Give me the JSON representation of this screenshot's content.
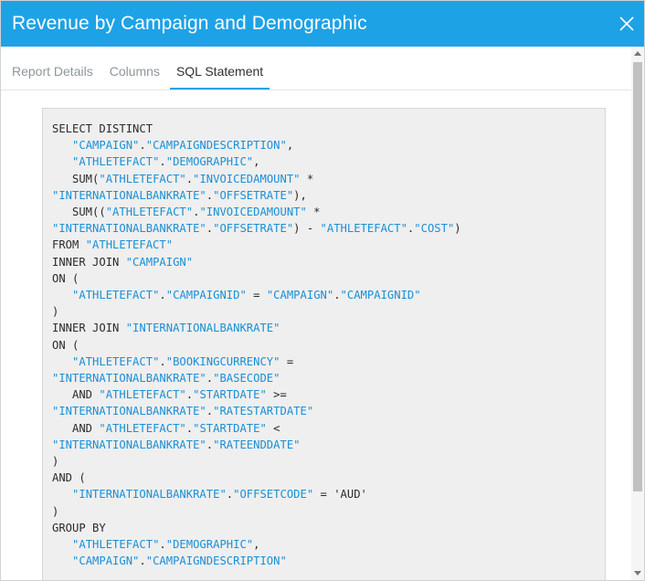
{
  "dialog": {
    "title": "Revenue by Campaign and Demographic",
    "close_icon": "close-icon"
  },
  "tabs": [
    {
      "label": "Report Details",
      "active": false
    },
    {
      "label": "Columns",
      "active": false
    },
    {
      "label": "SQL Statement",
      "active": true
    }
  ],
  "sql": {
    "lines": [
      [
        [
          "kw",
          "SELECT DISTINCT"
        ]
      ],
      [
        [
          "kw",
          "   "
        ],
        [
          "id",
          "\"CAMPAIGN\""
        ],
        [
          "kw",
          "."
        ],
        [
          "id",
          "\"CAMPAIGNDESCRIPTION\""
        ],
        [
          "kw",
          ","
        ]
      ],
      [
        [
          "kw",
          "   "
        ],
        [
          "id",
          "\"ATHLETEFACT\""
        ],
        [
          "kw",
          "."
        ],
        [
          "id",
          "\"DEMOGRAPHIC\""
        ],
        [
          "kw",
          ","
        ]
      ],
      [
        [
          "kw",
          "   SUM("
        ],
        [
          "id",
          "\"ATHLETEFACT\""
        ],
        [
          "kw",
          "."
        ],
        [
          "id",
          "\"INVOICEDAMOUNT\""
        ],
        [
          "kw",
          " *"
        ]
      ],
      [
        [
          "id",
          "\"INTERNATIONALBANKRATE\""
        ],
        [
          "kw",
          "."
        ],
        [
          "id",
          "\"OFFSETRATE\""
        ],
        [
          "kw",
          "),"
        ]
      ],
      [
        [
          "kw",
          "   SUM(("
        ],
        [
          "id",
          "\"ATHLETEFACT\""
        ],
        [
          "kw",
          "."
        ],
        [
          "id",
          "\"INVOICEDAMOUNT\""
        ],
        [
          "kw",
          " *"
        ]
      ],
      [
        [
          "id",
          "\"INTERNATIONALBANKRATE\""
        ],
        [
          "kw",
          "."
        ],
        [
          "id",
          "\"OFFSETRATE\""
        ],
        [
          "kw",
          ") - "
        ],
        [
          "id",
          "\"ATHLETEFACT\""
        ],
        [
          "kw",
          "."
        ],
        [
          "id",
          "\"COST\""
        ],
        [
          "kw",
          ")"
        ]
      ],
      [
        [
          "kw",
          "FROM "
        ],
        [
          "id",
          "\"ATHLETEFACT\""
        ]
      ],
      [
        [
          "kw",
          "INNER JOIN "
        ],
        [
          "id",
          "\"CAMPAIGN\""
        ]
      ],
      [
        [
          "kw",
          "ON ("
        ]
      ],
      [
        [
          "kw",
          "   "
        ],
        [
          "id",
          "\"ATHLETEFACT\""
        ],
        [
          "kw",
          "."
        ],
        [
          "id",
          "\"CAMPAIGNID\""
        ],
        [
          "kw",
          " = "
        ],
        [
          "id",
          "\"CAMPAIGN\""
        ],
        [
          "kw",
          "."
        ],
        [
          "id",
          "\"CAMPAIGNID\""
        ]
      ],
      [
        [
          "kw",
          ")"
        ]
      ],
      [
        [
          "kw",
          "INNER JOIN "
        ],
        [
          "id",
          "\"INTERNATIONALBANKRATE\""
        ]
      ],
      [
        [
          "kw",
          "ON ("
        ]
      ],
      [
        [
          "kw",
          "   "
        ],
        [
          "id",
          "\"ATHLETEFACT\""
        ],
        [
          "kw",
          "."
        ],
        [
          "id",
          "\"BOOKINGCURRENCY\""
        ],
        [
          "kw",
          " ="
        ]
      ],
      [
        [
          "id",
          "\"INTERNATIONALBANKRATE\""
        ],
        [
          "kw",
          "."
        ],
        [
          "id",
          "\"BASECODE\""
        ]
      ],
      [
        [
          "kw",
          "   AND "
        ],
        [
          "id",
          "\"ATHLETEFACT\""
        ],
        [
          "kw",
          "."
        ],
        [
          "id",
          "\"STARTDATE\""
        ],
        [
          "kw",
          " >="
        ]
      ],
      [
        [
          "id",
          "\"INTERNATIONALBANKRATE\""
        ],
        [
          "kw",
          "."
        ],
        [
          "id",
          "\"RATESTARTDATE\""
        ]
      ],
      [
        [
          "kw",
          "   AND "
        ],
        [
          "id",
          "\"ATHLETEFACT\""
        ],
        [
          "kw",
          "."
        ],
        [
          "id",
          "\"STARTDATE\""
        ],
        [
          "kw",
          " <"
        ]
      ],
      [
        [
          "id",
          "\"INTERNATIONALBANKRATE\""
        ],
        [
          "kw",
          "."
        ],
        [
          "id",
          "\"RATEENDDATE\""
        ]
      ],
      [
        [
          "kw",
          ")"
        ]
      ],
      [
        [
          "kw",
          "AND ("
        ]
      ],
      [
        [
          "kw",
          "   "
        ],
        [
          "id",
          "\"INTERNATIONALBANKRATE\""
        ],
        [
          "kw",
          "."
        ],
        [
          "id",
          "\"OFFSETCODE\""
        ],
        [
          "kw",
          " = 'AUD'"
        ]
      ],
      [
        [
          "kw",
          ")"
        ]
      ],
      [
        [
          "kw",
          "GROUP BY"
        ]
      ],
      [
        [
          "kw",
          "   "
        ],
        [
          "id",
          "\"ATHLETEFACT\""
        ],
        [
          "kw",
          "."
        ],
        [
          "id",
          "\"DEMOGRAPHIC\""
        ],
        [
          "kw",
          ","
        ]
      ],
      [
        [
          "kw",
          "   "
        ],
        [
          "id",
          "\"CAMPAIGN\""
        ],
        [
          "kw",
          "."
        ],
        [
          "id",
          "\"CAMPAIGNDESCRIPTION\""
        ]
      ]
    ]
  },
  "scrollbar": {
    "up_icon": "chevron-up-icon",
    "down_icon": "chevron-down-icon"
  },
  "colors": {
    "titlebar": "#1ea2e6",
    "identifier": "#1a8fd6",
    "tab_active_underline": "#1ea2e6"
  }
}
